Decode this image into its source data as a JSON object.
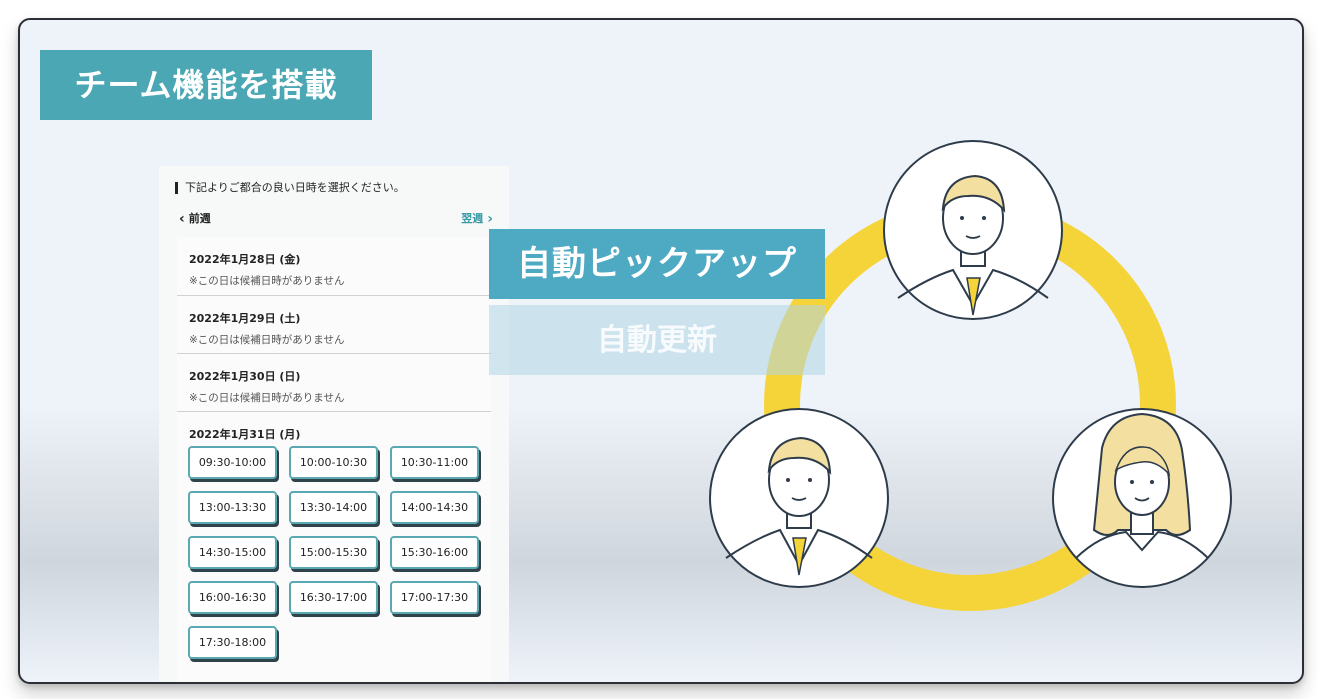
{
  "slide": {
    "title": "チーム機能を搭載",
    "pickup_label": "自動ピックアップ",
    "update_label": "自動更新"
  },
  "schedule": {
    "instruction": "下記よりご都合の良い日時を選択ください。",
    "prev_label": "前週",
    "next_label": "翌週",
    "days": [
      {
        "date": "2022年1月28日 (金)",
        "note": "※この日は候補日時がありません"
      },
      {
        "date": "2022年1月29日 (土)",
        "note": "※この日は候補日時がありません"
      },
      {
        "date": "2022年1月30日 (日)",
        "note": "※この日は候補日時がありません"
      },
      {
        "date": "2022年1月31日 (月)"
      }
    ],
    "slots": [
      "09:30-10:00",
      "10:00-10:30",
      "10:30-11:00",
      "13:00-13:30",
      "13:30-14:00",
      "14:00-14:30",
      "14:30-15:00",
      "15:00-15:30",
      "15:30-16:00",
      "16:00-16:30",
      "16:30-17:00",
      "17:00-17:30",
      "17:30-18:00"
    ]
  },
  "colors": {
    "banner": "#4ba7b3",
    "pickup": "#4ea9c3",
    "ring": "#f5d43a",
    "accent": "#3a9aa6"
  },
  "icons": [
    "chevron-left-icon",
    "chevron-right-icon",
    "person-man-icon",
    "person-woman-icon"
  ]
}
